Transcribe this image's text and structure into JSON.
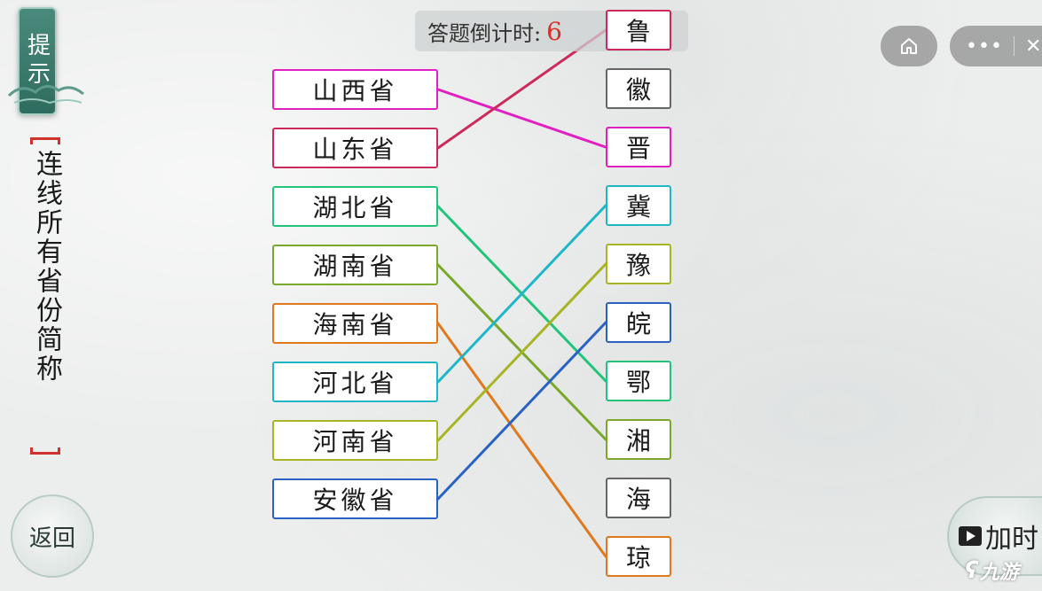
{
  "hint_button": {
    "label": "提示"
  },
  "instruction": {
    "text": "连线所有省份简称"
  },
  "timer": {
    "label": "答题倒计时:",
    "value": "6"
  },
  "provinces": [
    {
      "label": "山西省",
      "color": "#e020c0"
    },
    {
      "label": "山东省",
      "color": "#cc2a5a"
    },
    {
      "label": "湖北省",
      "color": "#22c47a"
    },
    {
      "label": "湖南省",
      "color": "#7aa82a"
    },
    {
      "label": "海南省",
      "color": "#e0781e"
    },
    {
      "label": "河北省",
      "color": "#1fb6c8"
    },
    {
      "label": "河南省",
      "color": "#a8b421"
    },
    {
      "label": "安徽省",
      "color": "#2a62c4"
    }
  ],
  "abbreviations": [
    {
      "label": "鲁",
      "color": "#cc2a5a"
    },
    {
      "label": "徽",
      "color": "#666666"
    },
    {
      "label": "晋",
      "color": "#e020c0"
    },
    {
      "label": "冀",
      "color": "#1fb6c8"
    },
    {
      "label": "豫",
      "color": "#a8b421"
    },
    {
      "label": "皖",
      "color": "#2a62c4"
    },
    {
      "label": "鄂",
      "color": "#22c47a"
    },
    {
      "label": "湘",
      "color": "#7aa82a"
    },
    {
      "label": "海",
      "color": "#666666"
    },
    {
      "label": "琼",
      "color": "#e0781e"
    }
  ],
  "connections": [
    {
      "from": 0,
      "to": 2
    },
    {
      "from": 1,
      "to": 0
    },
    {
      "from": 2,
      "to": 6
    },
    {
      "from": 3,
      "to": 7
    },
    {
      "from": 4,
      "to": 9
    },
    {
      "from": 5,
      "to": 3
    },
    {
      "from": 6,
      "to": 4
    },
    {
      "from": 7,
      "to": 5
    }
  ],
  "back_button": {
    "label": "返回"
  },
  "time_button": {
    "label": "加时"
  },
  "top_right": {
    "home_icon": "home-icon",
    "more_icon": "more-dots-icon",
    "close_icon": "close-icon"
  },
  "watermark": {
    "text": "九游"
  }
}
